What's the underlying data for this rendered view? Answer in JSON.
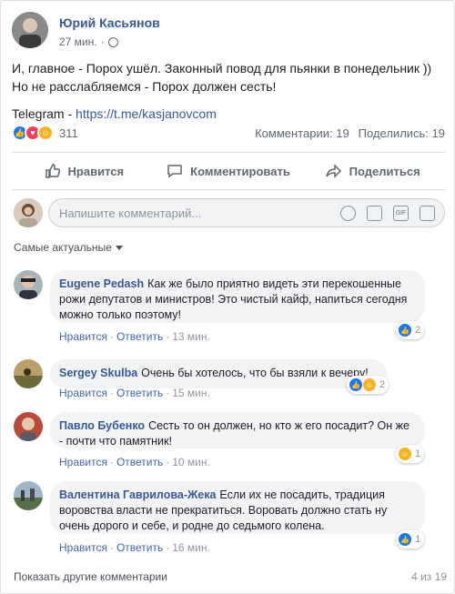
{
  "post": {
    "author": "Юрий Касьянов",
    "time": "27 мин.",
    "privacy_icon": "globe-icon",
    "text_lines": [
      "И, главное - Порох ушёл. Законный повод для пьянки в понедельник ))",
      "Но не расслабляемся - Порох должен сесть!"
    ],
    "telegram_label": "Telegram - ",
    "telegram_link": "https://t.me/kasjanovcom"
  },
  "summary": {
    "reaction_count": "311",
    "comments": "Комментарии: 19",
    "shares": "Поделились: 19"
  },
  "actions": {
    "like": "Нравится",
    "comment": "Комментировать",
    "share": "Поделиться"
  },
  "composer": {
    "placeholder": "Напишите комментарий...",
    "gif_label": "GIF"
  },
  "sort_label": "Самые актуальные",
  "comment_meta": {
    "like": "Нравится",
    "reply": "Ответить",
    "separator": "·"
  },
  "comments": [
    {
      "name": "Eugene Pedash",
      "text": "Как же было приятно видеть эти перекошенные рожи депутатов и министров! Это чистый кайф, напиться сегодня можно только поэтому!",
      "time": "13 мин.",
      "reaction_count": "2",
      "reactions": [
        "like"
      ]
    },
    {
      "name": "Sergey Skulba",
      "text": "Очень бы хотелось, что бы взяли к вечеру!",
      "time": "15 мин.",
      "reaction_count": "2",
      "reactions": [
        "like",
        "haha"
      ]
    },
    {
      "name": "Павло Бубенко",
      "text": "Сесть то он должен, но кто ж его посадит? Он же - почти что памятник!",
      "time": "10 мин.",
      "reaction_count": "1",
      "reactions": [
        "haha"
      ]
    },
    {
      "name": "Валентина Гаврилова-Жека",
      "text": "Если их не посадить, традиция воровства власти не прекратиться. Воровать должно стать ну очень дорого и себе, и родне до седьмого колена.",
      "time": "16 мин.",
      "reaction_count": "1",
      "reactions": [
        "like"
      ]
    }
  ],
  "footer": {
    "more": "Показать другие комментарии",
    "pager": "4 из 19"
  },
  "colors": {
    "link": "#385898",
    "like": "#1877f2",
    "love": "#f33e58",
    "haha": "#f7b125",
    "bubble": "#f2f3f5"
  }
}
